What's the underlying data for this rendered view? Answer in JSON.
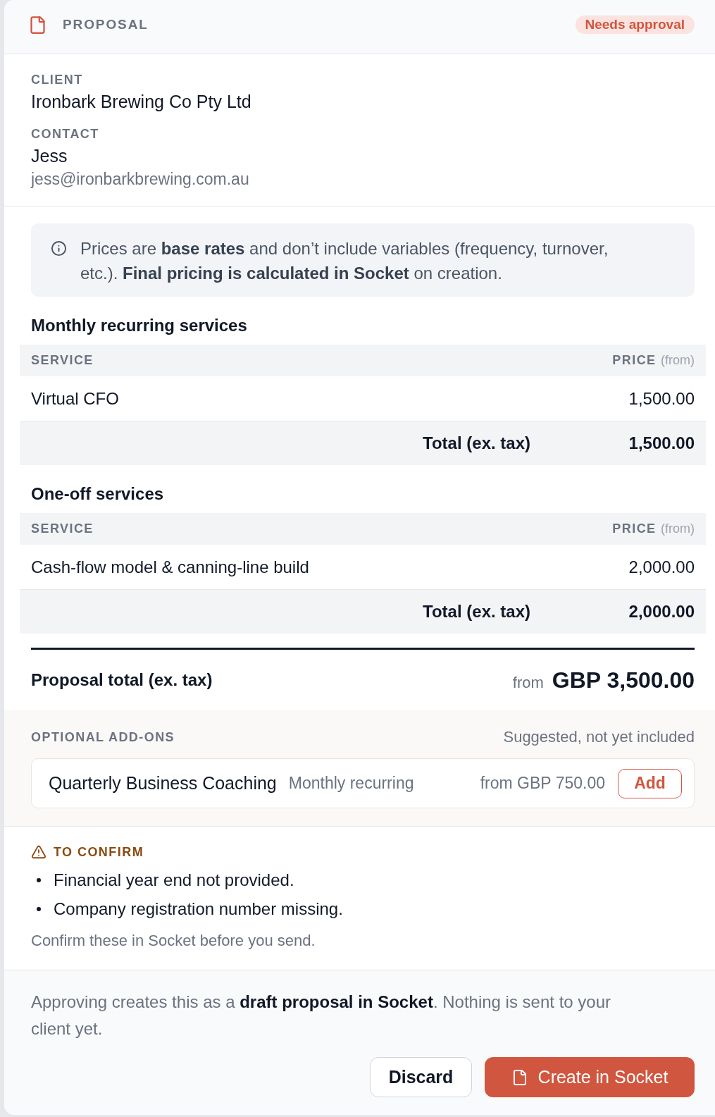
{
  "header": {
    "title": "PROPOSAL",
    "badge": "Needs approval"
  },
  "client": {
    "label": "CLIENT",
    "name": "Ironbark Brewing Co Pty Ltd"
  },
  "contact": {
    "label": "CONTACT",
    "name": "Jess",
    "email": "jess@ironbarkbrewing.com.au"
  },
  "notice": "Prices are **base rates** and don’t include variables (frequency, turnover, etc.). **Final pricing is calculated in Socket** on creation.",
  "sections": [
    {
      "title": "Monthly recurring services",
      "columns": {
        "service": "SERVICE",
        "price": "PRICE",
        "price_note": "(from)"
      },
      "rows": [
        {
          "service": "Virtual CFO",
          "price": "1,500.00"
        }
      ],
      "total": {
        "label": "Total (ex. tax)",
        "value": "1,500.00"
      }
    },
    {
      "title": "One-off services",
      "columns": {
        "service": "SERVICE",
        "price": "PRICE",
        "price_note": "(from)"
      },
      "rows": [
        {
          "service": "Cash-flow model & canning-line build",
          "price": "2,000.00"
        }
      ],
      "total": {
        "label": "Total (ex. tax)",
        "value": "2,000.00"
      }
    }
  ],
  "proposal_total": {
    "label": "Proposal total (ex. tax)",
    "prefix": "from",
    "value": "GBP 3,500.00"
  },
  "addons": {
    "title": "OPTIONAL ADD-ONS",
    "note": "Suggested, not yet included",
    "items": [
      {
        "name": "Quarterly Business Coaching",
        "frequency": "Monthly recurring",
        "price": "from GBP 750.00",
        "action": "Add"
      }
    ]
  },
  "to_confirm": {
    "title": "TO CONFIRM",
    "items": [
      "Financial year end not provided.",
      "Company registration number missing."
    ],
    "note": "Confirm these in Socket before you send."
  },
  "footer": {
    "message": "Approving creates this as a **draft proposal in Socket**. Nothing is sent to your client yet.",
    "buttons": [
      {
        "label": "Discard",
        "kind": "secondary"
      },
      {
        "label": "Create in Socket",
        "kind": "primary"
      }
    ]
  }
}
